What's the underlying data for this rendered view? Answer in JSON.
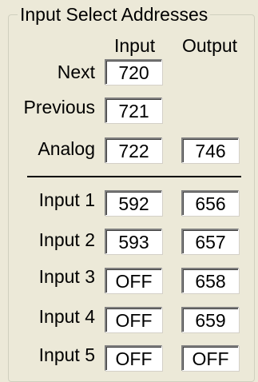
{
  "group": {
    "title": "Input Select Addresses"
  },
  "columns": {
    "input": "Input",
    "output": "Output"
  },
  "rows": [
    {
      "label": "Next",
      "input": "720",
      "output": null
    },
    {
      "label": "Previous",
      "input": "721",
      "output": null
    },
    {
      "label": "Analog",
      "input": "722",
      "output": "746"
    },
    {
      "label": "Input 1",
      "input": "592",
      "output": "656"
    },
    {
      "label": "Input 2",
      "input": "593",
      "output": "657"
    },
    {
      "label": "Input 3",
      "input": "OFF",
      "output": "658"
    },
    {
      "label": "Input 4",
      "input": "OFF",
      "output": "659"
    },
    {
      "label": "Input 5",
      "input": "OFF",
      "output": "OFF"
    }
  ]
}
